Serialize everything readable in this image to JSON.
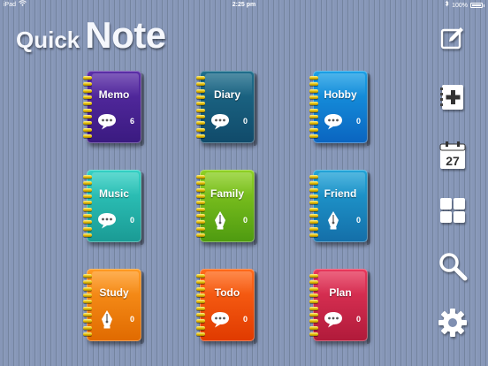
{
  "status_bar": {
    "device": "iPad",
    "time": "2:25 pm",
    "battery": "100%"
  },
  "title": {
    "part1": "Quick",
    "part2": "Note"
  },
  "notebooks": [
    {
      "label": "Memo",
      "count": "6",
      "icon": "speech-bubble-icon",
      "color_top": "#5b2ea8",
      "color_bottom": "#3a1a80"
    },
    {
      "label": "Diary",
      "count": "0",
      "icon": "speech-bubble-icon",
      "color_top": "#1f6e8c",
      "color_bottom": "#104a6a"
    },
    {
      "label": "Hobby",
      "count": "0",
      "icon": "speech-bubble-icon",
      "color_top": "#1aa0e6",
      "color_bottom": "#0a64c0"
    },
    {
      "label": "Music",
      "count": "0",
      "icon": "speech-bubble-icon",
      "color_top": "#33d0c4",
      "color_bottom": "#1a9a94"
    },
    {
      "label": "Family",
      "count": "0",
      "icon": "fountain-pen-icon",
      "color_top": "#8ed024",
      "color_bottom": "#4e9a10"
    },
    {
      "label": "Friend",
      "count": "0",
      "icon": "fountain-pen-icon",
      "color_top": "#22a4d8",
      "color_bottom": "#146ea8"
    },
    {
      "label": "Study",
      "count": "0",
      "icon": "fountain-pen-icon",
      "color_top": "#ff9a22",
      "color_bottom": "#e06a00"
    },
    {
      "label": "Todo",
      "count": "0",
      "icon": "speech-bubble-icon",
      "color_top": "#ff6a1a",
      "color_bottom": "#e03a00"
    },
    {
      "label": "Plan",
      "count": "0",
      "icon": "speech-bubble-icon",
      "color_top": "#e8385c",
      "color_bottom": "#b01a3a"
    }
  ],
  "sidebar": {
    "calendar_day": "27",
    "items": [
      "compose-icon",
      "add-icon",
      "calendar-icon",
      "grid-icon",
      "search-icon",
      "gear-icon"
    ]
  }
}
